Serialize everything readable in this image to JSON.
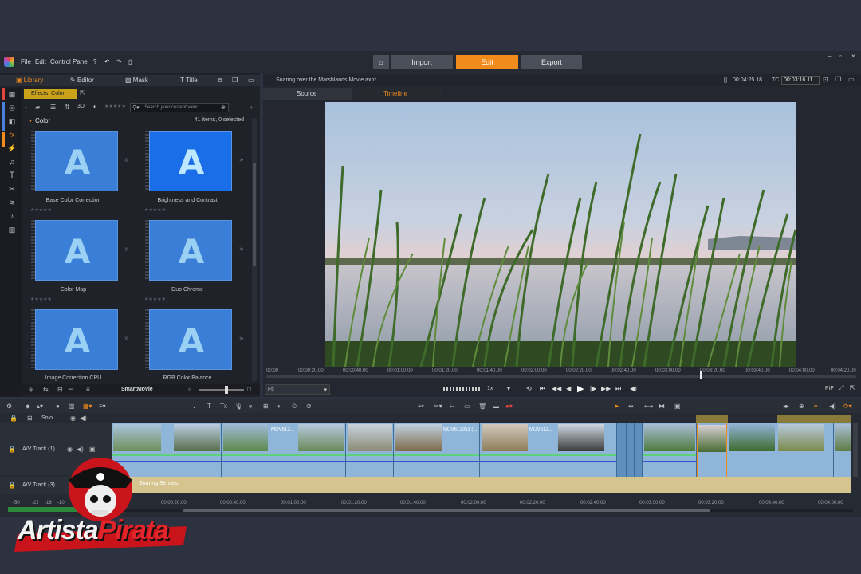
{
  "menu": {
    "file": "File",
    "edit": "Edit",
    "control_panel": "Control Panel"
  },
  "nav": {
    "import": "Import",
    "edit": "Edit",
    "export": "Export"
  },
  "library_tabs": {
    "library": "Library",
    "editor": "Editor",
    "mask": "Mask",
    "title": "Title"
  },
  "effects_tag": "Effects: Color",
  "toolbar": {
    "threed": "3D",
    "search_placeholder": "Search your current view"
  },
  "category": {
    "name": "Color",
    "count": "41 items, 0 selected"
  },
  "effects": [
    "Base Color Correction",
    "Brightness and Contrast",
    "Color Map",
    "Duo Chrome",
    "Image Correction CPU",
    "RGB Color Balance"
  ],
  "smartmovie": "SmartMovie",
  "project": {
    "title": "Soaring over the Marshlands.Movie.axp*",
    "duration": "00:04:25.18",
    "tc_label": "TC",
    "tc": "00:03:16.11"
  },
  "player_tabs": {
    "source": "Source",
    "timeline": "Timeline"
  },
  "ruler_ticks": [
    "00:00",
    "00:00:20.00",
    "00:00:40.00",
    "00:01:00.00",
    "00:01:20.00",
    "00:01:40.00",
    "00:02:00.00",
    "00:02:20.00",
    "00:02:40.00",
    "00:03:00.00",
    "00:03:20.00",
    "00:03:40.00",
    "00:04:00.00",
    "00:04:20.00"
  ],
  "player": {
    "fit": "Fit",
    "speed": "1x",
    "pip": "PiP"
  },
  "tracks": {
    "solo": "Solo",
    "av1": "A/V Track (1)",
    "av3": "A/V Track (3)",
    "audio_clip": "Soaring Senses"
  },
  "clips": [
    "MOV612...",
    "MOV612353 (...",
    "MOV612..."
  ],
  "bottom_ticks": [
    "00:00:20.00",
    "00:00:40.00",
    "00:01:00.00",
    "00:01:20.00",
    "00:01:40.00",
    "00:02:00.00",
    "00:02:20.00",
    "00:02:40.00",
    "00:03:00.00",
    "00:03:20.00",
    "00:03:40.00",
    "00:04:00.00"
  ],
  "vol_ticks": [
    "-50",
    "-22",
    "-16",
    "-10"
  ],
  "watermark": {
    "word1": "Artista",
    "word2": "Pirata"
  },
  "colors": {
    "accent": "#f18b1b",
    "thumb": "#3a7ed7",
    "audio": "#d6c48e"
  }
}
